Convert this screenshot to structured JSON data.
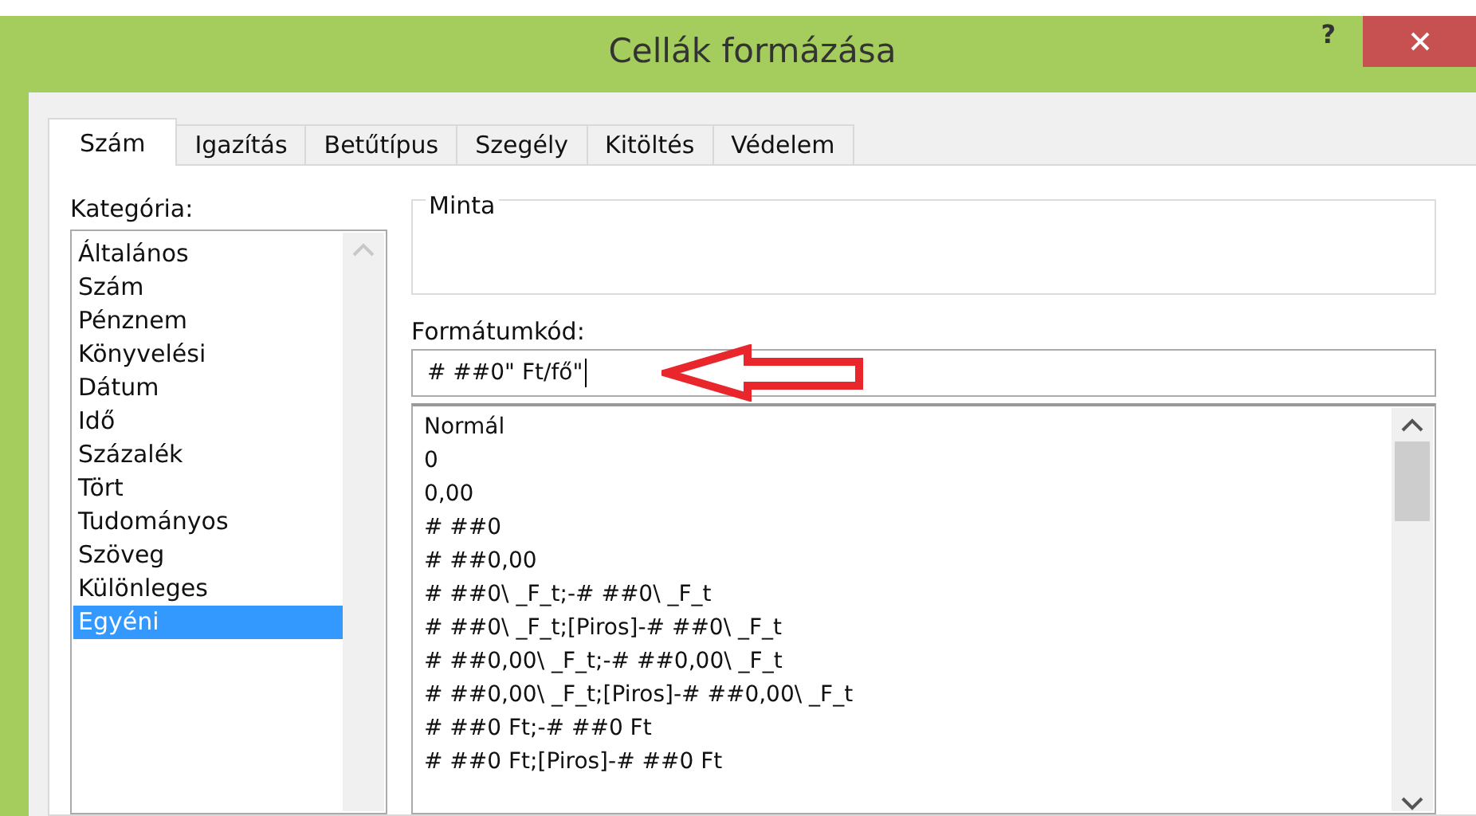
{
  "window": {
    "title": "Cellák formázása",
    "help": "?"
  },
  "tabs": [
    {
      "label": "Szám",
      "selected": true
    },
    {
      "label": "Igazítás",
      "selected": false
    },
    {
      "label": "Betűtípus",
      "selected": false
    },
    {
      "label": "Szegély",
      "selected": false
    },
    {
      "label": "Kitöltés",
      "selected": false
    },
    {
      "label": "Védelem",
      "selected": false
    }
  ],
  "category": {
    "label": "Kategória:",
    "items": [
      {
        "label": "Általános",
        "selected": false
      },
      {
        "label": "Szám",
        "selected": false
      },
      {
        "label": "Pénznem",
        "selected": false
      },
      {
        "label": "Könyvelési",
        "selected": false
      },
      {
        "label": "Dátum",
        "selected": false
      },
      {
        "label": "Idő",
        "selected": false
      },
      {
        "label": "Százalék",
        "selected": false
      },
      {
        "label": "Tört",
        "selected": false
      },
      {
        "label": "Tudományos",
        "selected": false
      },
      {
        "label": "Szöveg",
        "selected": false
      },
      {
        "label": "Különleges",
        "selected": false
      },
      {
        "label": "Egyéni",
        "selected": true
      }
    ]
  },
  "sample": {
    "label": "Minta"
  },
  "format_code": {
    "label": "Formátumkód:",
    "value": "# ##0\" Ft/fő\""
  },
  "format_list": [
    "Normál",
    "0",
    "0,00",
    "# ##0",
    "# ##0,00",
    "# ##0\\ _F_t;-# ##0\\ _F_t",
    "# ##0\\ _F_t;[Piros]-# ##0\\ _F_t",
    "# ##0,00\\ _F_t;-# ##0,00\\ _F_t",
    "# ##0,00\\ _F_t;[Piros]-# ##0,00\\ _F_t",
    "# ##0 Ft;-# ##0 Ft",
    "# ##0 Ft;[Piros]-# ##0 Ft"
  ]
}
